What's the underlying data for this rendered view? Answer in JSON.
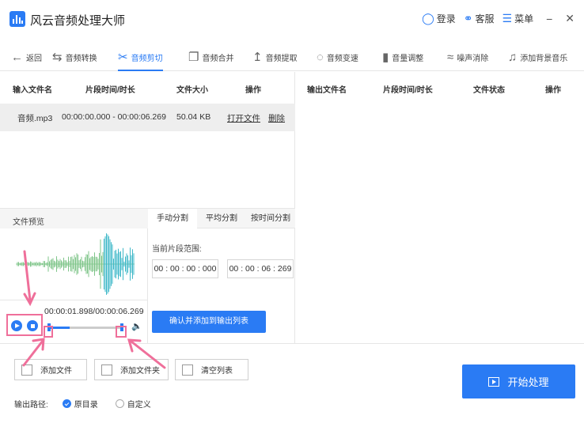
{
  "app": {
    "title": "风云音频处理大师"
  },
  "header": {
    "login": "登录",
    "service": "客服",
    "menu": "菜单",
    "minimize": "−",
    "close": "✕"
  },
  "toolbar": {
    "back": "返回",
    "items": [
      "音频转换",
      "音频剪切",
      "音频合并",
      "音频提取",
      "音频变速",
      "音量调整",
      "噪声消除",
      "添加背景音乐"
    ],
    "active_index": 1
  },
  "input_table": {
    "headers": [
      "输入文件名",
      "片段时间/时长",
      "文件大小",
      "操作"
    ],
    "rows": [
      {
        "name": "音频.mp3",
        "segment": "00:00:00.000 - 00:00:06.269",
        "size": "50.04 KB",
        "open": "打开文件",
        "delete": "删除"
      }
    ]
  },
  "output_table": {
    "headers": [
      "输出文件名",
      "片段时间/时长",
      "文件状态",
      "操作"
    ]
  },
  "preview": {
    "label": "文件预览",
    "time": "00:00:01.898/00:00:06.269",
    "progress": 0.3
  },
  "split_tabs": {
    "tabs": [
      "手动分割",
      "平均分割",
      "按时间分割"
    ],
    "active": 0
  },
  "split": {
    "range_label": "当前片段范围:",
    "start": "00 : 00 : 00 : 000",
    "end": "00 : 00 : 06 : 269",
    "confirm": "确认并添加到输出列表"
  },
  "bottom": {
    "add_file": "添加文件",
    "add_folder": "添加文件夹",
    "clear_list": "清空列表",
    "start": "开始处理",
    "output_path_label": "输出路径:",
    "options": [
      "原目录",
      "自定义"
    ],
    "selected": 0
  },
  "colors": {
    "accent": "#2a7bf4",
    "annotation": "#ef6f9a",
    "wave_green": "#7fc58a",
    "wave_teal": "#3fb8c8"
  }
}
